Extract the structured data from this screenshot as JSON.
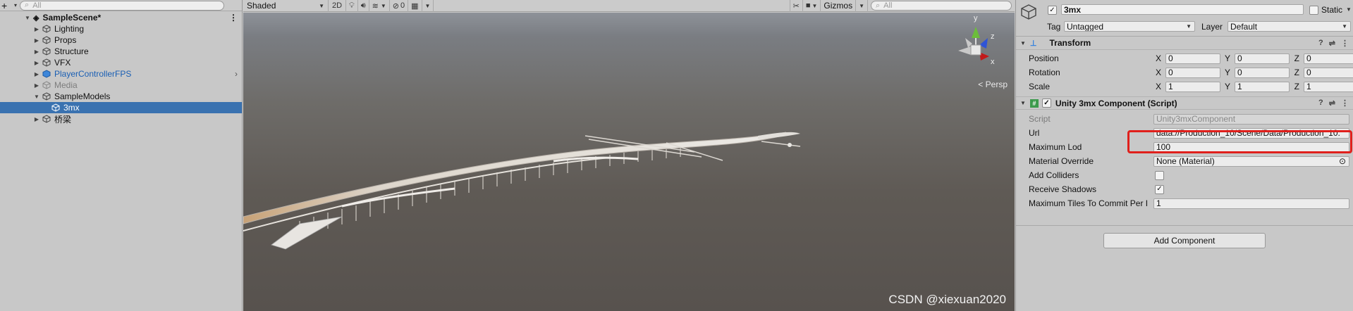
{
  "hierarchy": {
    "search_placeholder": "All",
    "scene_name": "SampleScene*",
    "items": [
      {
        "label": "Lighting"
      },
      {
        "label": "Props"
      },
      {
        "label": "Structure"
      },
      {
        "label": "VFX"
      },
      {
        "label": "PlayerControllerFPS"
      },
      {
        "label": "Media"
      },
      {
        "label": "SampleModels"
      },
      {
        "label": "3mx"
      },
      {
        "label": "桥梁"
      }
    ]
  },
  "scene": {
    "shading_mode": "Shaded",
    "mode_2d": "2D",
    "fx_count": "0",
    "gizmos_label": "Gizmos",
    "search_placeholder": "All",
    "persp_label": "< Persp",
    "axis_y": "y",
    "axis_x": "x",
    "axis_z": "z"
  },
  "inspector": {
    "object_name": "3mx",
    "static_label": "Static",
    "tag_label": "Tag",
    "tag_value": "Untagged",
    "layer_label": "Layer",
    "layer_value": "Default",
    "transform": {
      "title": "Transform",
      "rows": [
        {
          "label": "Position",
          "x": "0",
          "y": "0",
          "z": "0"
        },
        {
          "label": "Rotation",
          "x": "0",
          "y": "0",
          "z": "0"
        },
        {
          "label": "Scale",
          "x": "1",
          "y": "1",
          "z": "1"
        }
      ]
    },
    "component": {
      "title": "Unity 3mx Component (Script)",
      "script_label": "Script",
      "script_value": "Unity3mxComponent",
      "url_label": "Url",
      "url_value": "data://Production_10/Scene/Data/Production_10.",
      "max_lod_label": "Maximum Lod",
      "max_lod_value": "100",
      "material_label": "Material Override",
      "material_value": "None (Material)",
      "colliders_label": "Add Colliders",
      "shadows_label": "Receive Shadows",
      "tiles_label": "Maximum Tiles To Commit Per I",
      "tiles_value": "1"
    },
    "add_component": "Add Component"
  },
  "watermark": "CSDN @xiexuan2020"
}
